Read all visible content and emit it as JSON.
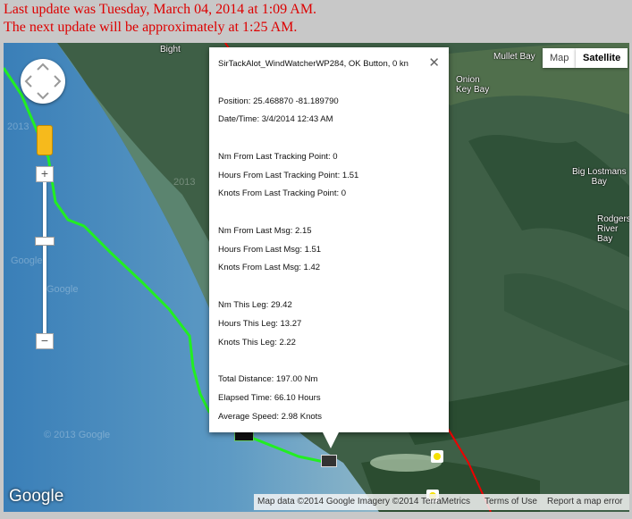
{
  "header": {
    "last_update": "Last update was Tuesday, March 04, 2014 at 1:09 AM.",
    "next_update": "The next update will be approximately at 1:25 AM."
  },
  "map": {
    "type_buttons": {
      "map": "Map",
      "satellite": "Satellite"
    },
    "place_labels": {
      "bight": "Bight",
      "mullet_bay": "Mullet Bay",
      "onion_key_bay": "Onion\nKey Bay",
      "big_lostmans_bay": "Big Lostmans\nBay",
      "rodgers_river_bay": "Rodgers\nRiver Bay"
    },
    "watermarks": [
      "© 2013 Google",
      "© 2013 Google",
      "Google",
      "Google",
      "2013",
      "© 2013 Google"
    ],
    "zoom": {
      "plus": "+",
      "minus": "−"
    },
    "google_logo": "Google",
    "attribution": {
      "data": "Map data ©2014 Google Imagery ©2014 TerraMetrics",
      "terms": "Terms of Use",
      "report": "Report a map error"
    },
    "colors": {
      "track": "#22ee22",
      "leg_line": "#ee0000"
    }
  },
  "popup": {
    "title": "SirTackAlot_WindWatcherWP284, OK Button, 0 kn",
    "close": "✕",
    "position": "Position: 25.468870 -81.189790",
    "datetime": "Date/Time: 3/4/2014 12:43 AM",
    "nm_last_tracking": "Nm From Last Tracking Point: 0",
    "hours_last_tracking": "Hours From Last Tracking Point: 1.51",
    "knots_last_tracking": "Knots From Last Tracking Point: 0",
    "nm_last_msg": "Nm From Last Msg: 2.15",
    "hours_last_msg": "Hours From Last Msg: 1.51",
    "knots_last_msg": "Knots From Last Msg: 1.42",
    "nm_leg": "Nm This Leg: 29.42",
    "hours_leg": "Hours This Leg: 13.27",
    "knots_leg": "Knots This Leg: 2.22",
    "total_distance": "Total Distance: 197.00 Nm",
    "elapsed_time": "Elapsed Time: 66.10 Hours",
    "average_speed": "Average Speed: 2.98 Knots"
  }
}
